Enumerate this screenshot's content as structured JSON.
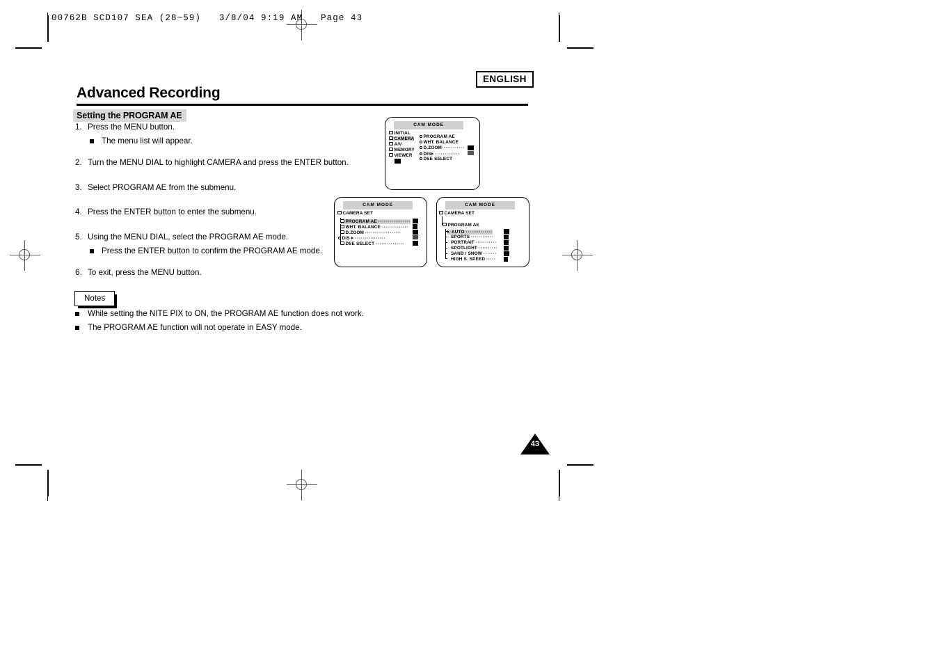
{
  "print_marks": {
    "imposition_line": "00762B SCD107 SEA (28~59)   3/8/04 9:19 AM   Page 43"
  },
  "header": {
    "language_badge": "ENGLISH",
    "title": "Advanced Recording",
    "section_heading": "Setting the PROGRAM AE"
  },
  "steps": [
    {
      "num": "1.",
      "text": "Press the MENU button.",
      "substeps": [
        "The menu list will appear."
      ]
    },
    {
      "num": "2.",
      "text": "Turn the MENU DIAL to highlight CAMERA and press the ENTER button.",
      "substeps": []
    },
    {
      "num": "3.",
      "text": "Select PROGRAM AE from the submenu.",
      "substeps": []
    },
    {
      "num": "4.",
      "text": "Press the ENTER button to enter the submenu.",
      "substeps": []
    },
    {
      "num": "5.",
      "text": "Using the MENU DIAL, select the PROGRAM AE mode.",
      "substeps": [
        "Press the ENTER button to confirm the PROGRAM AE mode."
      ]
    },
    {
      "num": "6.",
      "text": "To exit, press the MENU button.",
      "substeps": []
    }
  ],
  "notes": {
    "label": "Notes",
    "items": [
      "While setting the NITE PIX to ON, the PROGRAM AE function does not work.",
      "The PROGRAM AE function will not operate in EASY mode."
    ]
  },
  "lcd_screens": {
    "main_menu": {
      "title": "CAM MODE",
      "left_items": [
        {
          "label": "INITIAL",
          "highlighted": false
        },
        {
          "label": "CAMERA",
          "highlighted": true
        },
        {
          "label": "A/V",
          "highlighted": false
        },
        {
          "label": "MEMORY",
          "highlighted": false
        },
        {
          "label": "VIEWER",
          "highlighted": false
        }
      ],
      "right_items": [
        {
          "label": "PROGRAM AE",
          "dots": "",
          "value": ""
        },
        {
          "label": "WHT. BALANCE",
          "dots": "",
          "value": ""
        },
        {
          "label": "D.ZOOM",
          "dots": "············",
          "value": "block"
        },
        {
          "label": "DIS",
          "dots": "·············",
          "value": "block"
        },
        {
          "label": "DSE SELECT",
          "dots": "",
          "value": ""
        }
      ]
    },
    "camera_set": {
      "title": "CAM MODE",
      "breadcrumb": "CAMERA SET",
      "items": [
        {
          "label": "PROGRAM AE",
          "dots": "·················",
          "highlighted": true
        },
        {
          "label": "WHT. BALANCE",
          "dots": "··············",
          "highlighted": false
        },
        {
          "label": "D.ZOOM",
          "dots": "···················",
          "highlighted": false
        },
        {
          "label": "DIS",
          "dots": "················",
          "highlighted": false
        },
        {
          "label": "DSE SELECT",
          "dots": "···············",
          "highlighted": false
        }
      ]
    },
    "program_ae": {
      "title": "CAM MODE",
      "breadcrumb": "CAMERA SET",
      "submenu": "PROGRAM AE",
      "options": [
        {
          "label": "AUTO",
          "dots": "··············",
          "selected": true
        },
        {
          "label": "SPORTS",
          "dots": "············",
          "selected": false
        },
        {
          "label": "PORTRAIT",
          "dots": "···········",
          "selected": false
        },
        {
          "label": "SPOTLIGHT",
          "dots": "··········",
          "selected": false
        },
        {
          "label": "SAND / SNOW",
          "dots": "·······",
          "selected": false
        },
        {
          "label": "HIGH S. SPEED",
          "dots": "·····",
          "selected": false
        }
      ]
    }
  },
  "footer": {
    "page_number": "43"
  }
}
